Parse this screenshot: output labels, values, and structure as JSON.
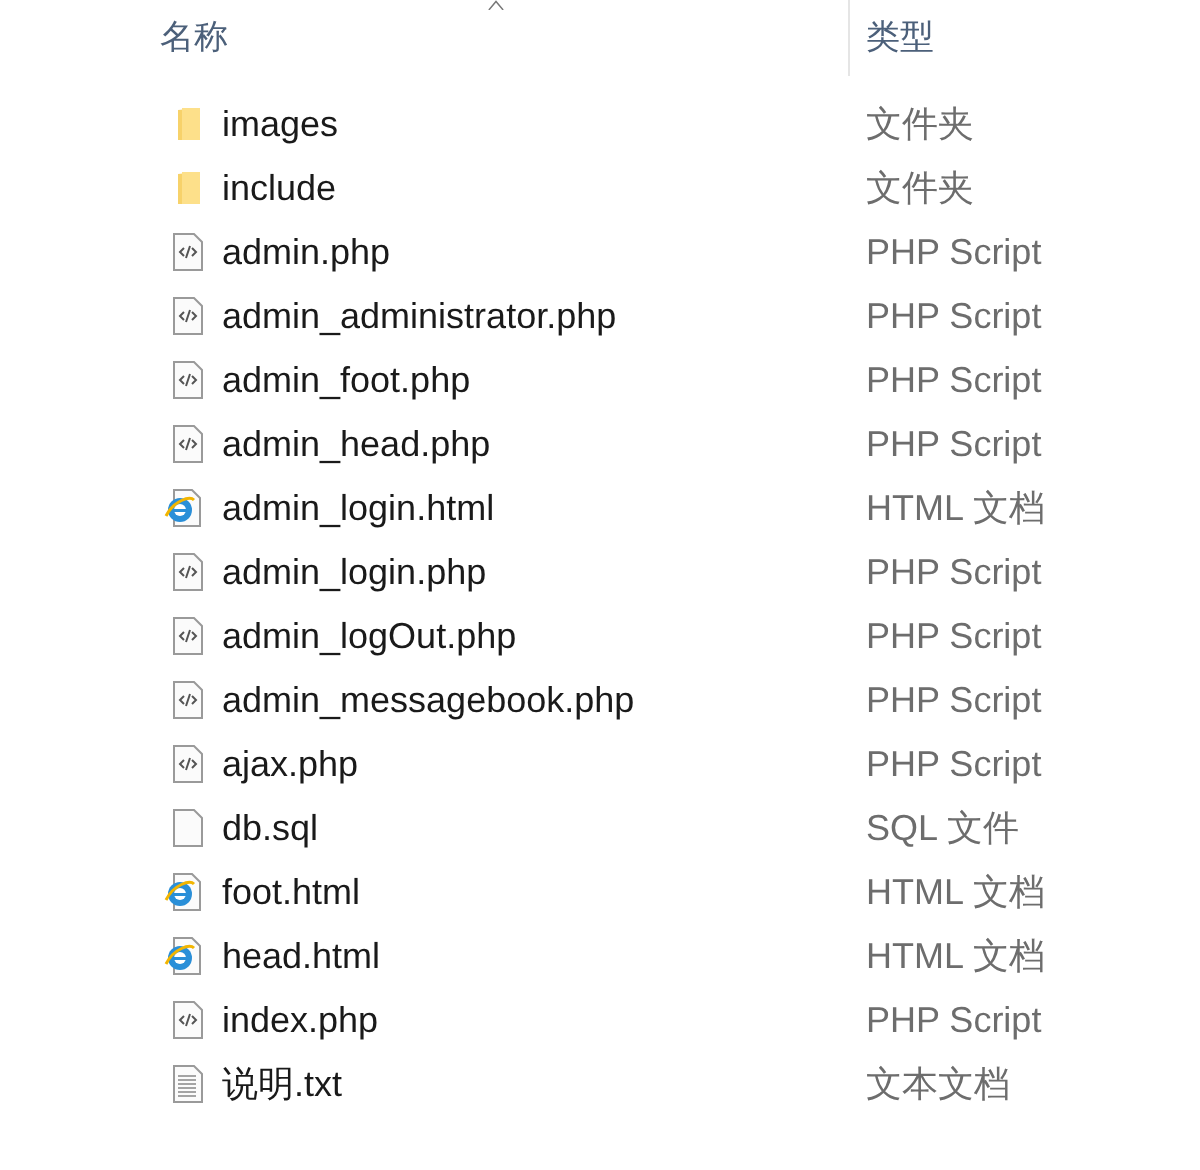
{
  "columns": [
    {
      "label": "名称"
    },
    {
      "label": "类型"
    }
  ],
  "rows": [
    {
      "name": "images",
      "type": "文件夹",
      "kind": "folder"
    },
    {
      "name": "include",
      "type": "文件夹",
      "kind": "folder"
    },
    {
      "name": "admin.php",
      "type": "PHP Script",
      "kind": "php"
    },
    {
      "name": "admin_administrator.php",
      "type": "PHP Script",
      "kind": "php"
    },
    {
      "name": "admin_foot.php",
      "type": "PHP Script",
      "kind": "php"
    },
    {
      "name": "admin_head.php",
      "type": "PHP Script",
      "kind": "php"
    },
    {
      "name": "admin_login.html",
      "type": "HTML 文档",
      "kind": "html"
    },
    {
      "name": "admin_login.php",
      "type": "PHP Script",
      "kind": "php"
    },
    {
      "name": "admin_logOut.php",
      "type": "PHP Script",
      "kind": "php"
    },
    {
      "name": "admin_messagebook.php",
      "type": "PHP Script",
      "kind": "php"
    },
    {
      "name": "ajax.php",
      "type": "PHP Script",
      "kind": "php"
    },
    {
      "name": "db.sql",
      "type": "SQL 文件",
      "kind": "file"
    },
    {
      "name": "foot.html",
      "type": "HTML 文档",
      "kind": "html"
    },
    {
      "name": "head.html",
      "type": "HTML 文档",
      "kind": "html"
    },
    {
      "name": "index.php",
      "type": "PHP Script",
      "kind": "php"
    },
    {
      "name": "说明.txt",
      "type": "文本文档",
      "kind": "txt"
    }
  ]
}
